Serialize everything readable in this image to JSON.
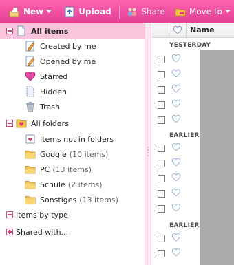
{
  "toolbar": {
    "new_label": "New",
    "upload_label": "Upload",
    "share_label": "Share",
    "move_to_label": "Move to"
  },
  "sidebar": {
    "all_items": "All items",
    "created_by_me": "Created by me",
    "opened_by_me": "Opened by me",
    "starred": "Starred",
    "hidden": "Hidden",
    "trash": "Trash",
    "all_folders": "All folders",
    "items_not_in_folders": "Items not in folders",
    "folders": [
      {
        "name": "Google",
        "count": "(10 items)"
      },
      {
        "name": "PC",
        "count": "(13 items)"
      },
      {
        "name": "Schule",
        "count": "(2 items)"
      },
      {
        "name": "Sonstiges",
        "count": "(13 items)"
      }
    ],
    "items_by_type": "Items by type",
    "shared_with": "Shared with..."
  },
  "list": {
    "name_header": "Name",
    "groups": [
      "YESTERDAY",
      "EARLIER",
      "EARLIER"
    ]
  },
  "colors": {
    "toolbar_pink": "#e8479a",
    "selected_row": "#f9c5dc",
    "accent": "#d0457f"
  }
}
